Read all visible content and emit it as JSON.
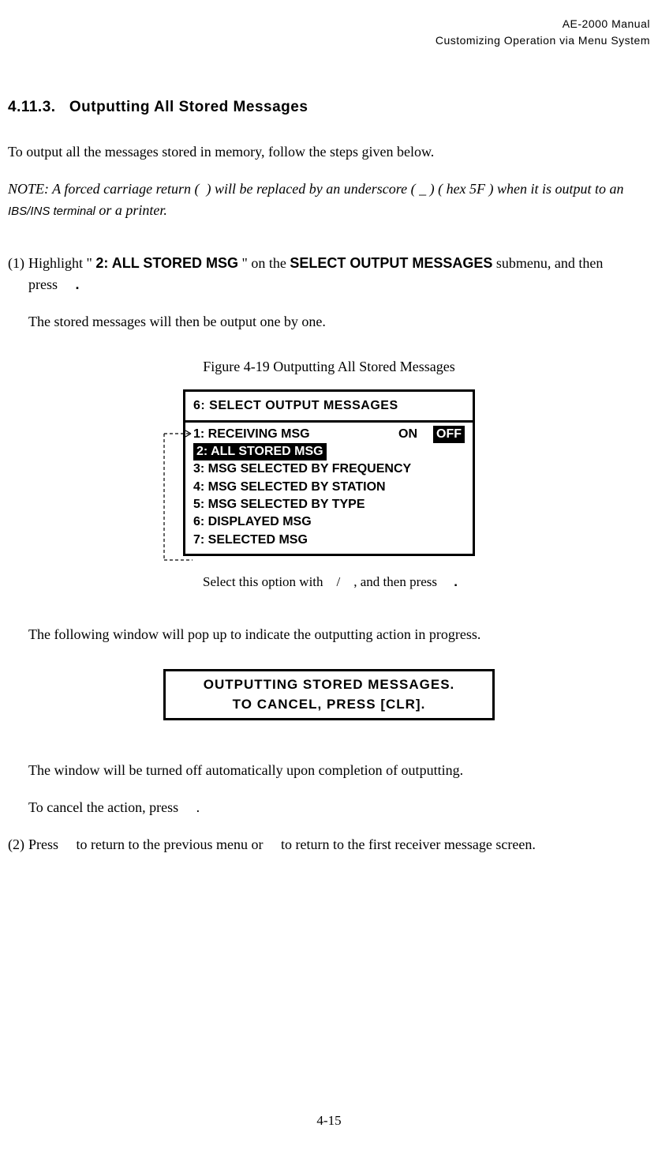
{
  "header": {
    "manual": "AE-2000 Manual",
    "chapter": "Customizing Operation via Menu System"
  },
  "section": {
    "number": "4.11.3.",
    "title": "Outputting All Stored Messages"
  },
  "intro": "To output all the messages stored in memory, follow the steps given below.",
  "note": {
    "prefix": "NOTE: A forced carriage return (",
    "mid1": ") will be replaced by an underscore ( _ ) ( hex 5F ) when it is output to an ",
    "ibs": "IBS/INS terminal",
    "suffix": " or a printer."
  },
  "step1": {
    "num": "(1)",
    "before": "Highlight \" ",
    "bold1": "2: ALL STORED MSG",
    "middle": " \" on the ",
    "bold2": "SELECT OUTPUT MESSAGES",
    "after": " submenu, and then press",
    "period": "."
  },
  "step1sub": "The stored messages will then be output one by one.",
  "figure": {
    "caption": "Figure 4-19   Outputting All Stored Messages",
    "title": "6: SELECT OUTPUT MESSAGES",
    "line1_label": "1: RECEIVING MSG",
    "line1_on": "ON",
    "line1_off": "OFF",
    "line2": "2: ALL STORED MSG",
    "line3": "3: MSG SELECTED BY FREQUENCY",
    "line4": "4: MSG SELECTED BY STATION",
    "line5": "5: MSG SELECTED BY TYPE",
    "line6": "6: DISPLAYED MSG",
    "line7": "7: SELECTED MSG"
  },
  "select_caption": {
    "text1": "Select this option with",
    "text2": "/",
    "text3": ", and then press",
    "period": "."
  },
  "following_line": "The following window will pop up to indicate the outputting action in progress.",
  "popup": {
    "line1": "OUTPUTTING STORED MESSAGES.",
    "line2": "TO CANCEL, PRESS [CLR]."
  },
  "turnoff_line": "The window will be turned off automatically upon completion of outputting.",
  "cancel_line": "To cancel the action, press",
  "cancel_period": ".",
  "step2": {
    "num": "(2)",
    "text1": "Press",
    "text2": "to return to the previous menu or",
    "text3": "to return to the first receiver message screen."
  },
  "page_number": "4-15"
}
